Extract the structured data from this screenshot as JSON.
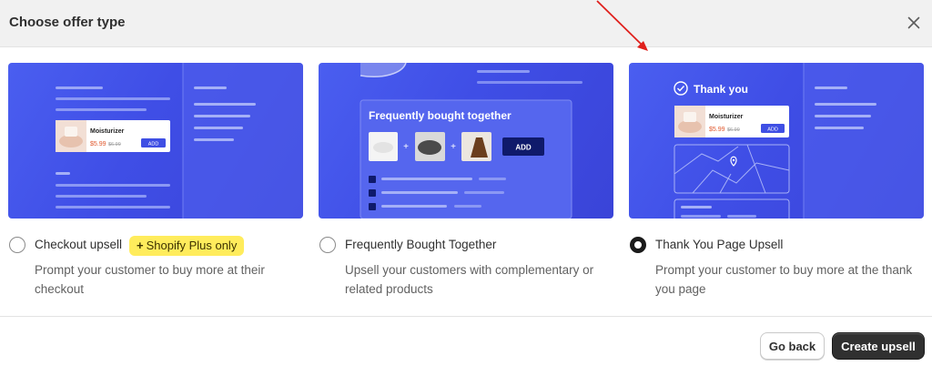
{
  "modal": {
    "title": "Choose offer type",
    "close_icon": "close-icon"
  },
  "options": [
    {
      "label": "Checkout upsell",
      "badge": "Shopify Plus only",
      "description": "Prompt your customer to buy more at their checkout",
      "selected": false,
      "preview": {
        "product_name": "Moisturizer",
        "price": "$5.99",
        "old_price": "$6.99",
        "add_label": "ADD"
      }
    },
    {
      "label": "Frequently Bought Together",
      "description": "Upsell your customers with complementary or related products",
      "selected": false,
      "preview": {
        "heading": "Frequently bought together",
        "add_label": "ADD"
      }
    },
    {
      "label": "Thank You Page Upsell",
      "description": "Prompt your customer to buy more at the thank you page",
      "selected": true,
      "preview": {
        "heading": "Thank you",
        "product_name": "Moisturizer",
        "price": "$5.99",
        "old_price": "$6.99",
        "add_label": "ADD"
      }
    }
  ],
  "footer": {
    "back_label": "Go back",
    "create_label": "Create upsell"
  },
  "colors": {
    "card_blue": "#4354e8",
    "selected_radio": "#1a1a1a",
    "badge_yellow": "#ffec5c",
    "primary_button": "#303030",
    "annotation_arrow": "#e0201c"
  }
}
